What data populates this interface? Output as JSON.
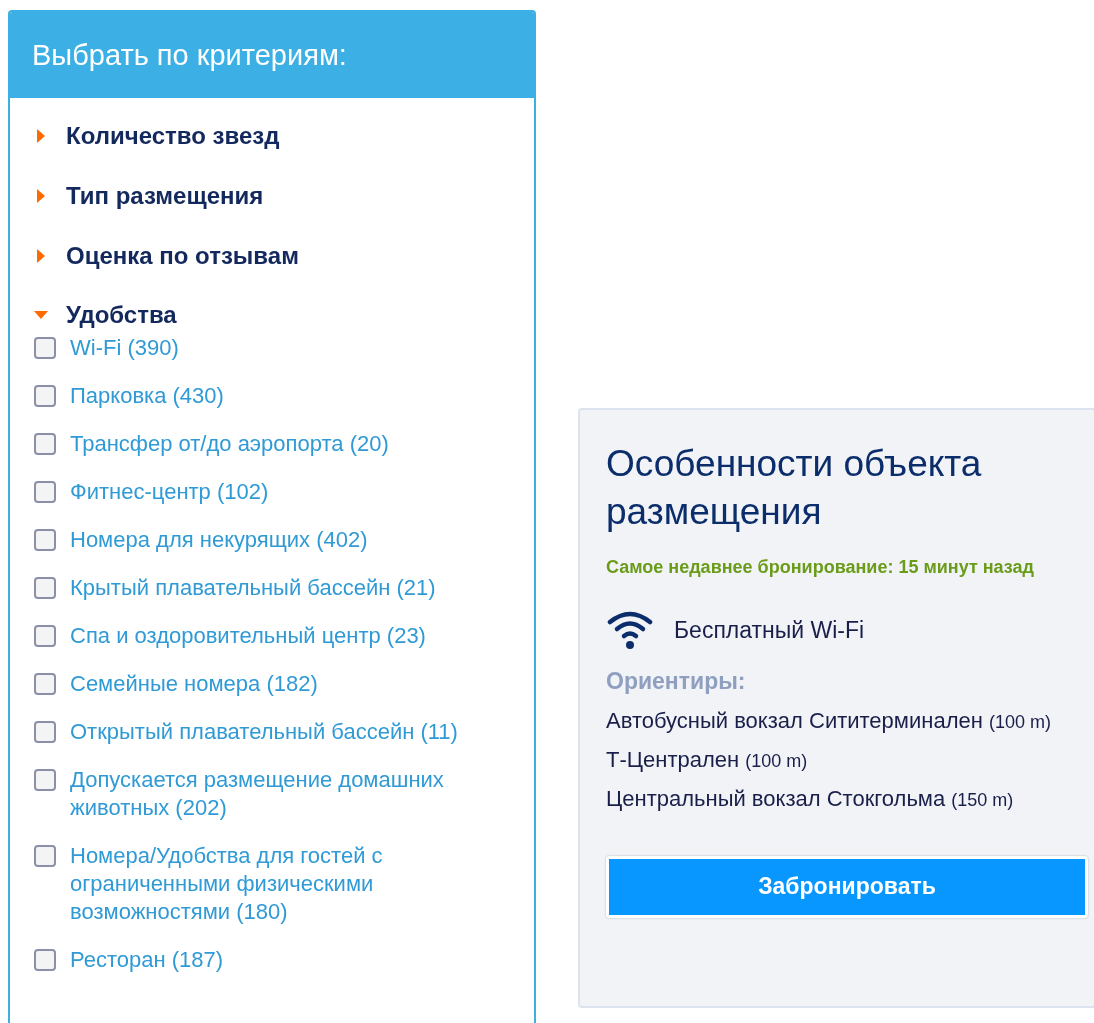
{
  "filter_panel": {
    "title": "Выбрать по критериям:",
    "sections": [
      {
        "label": "Количество звезд",
        "expanded": false
      },
      {
        "label": "Тип размещения",
        "expanded": false
      },
      {
        "label": "Оценка по отзывам",
        "expanded": false
      },
      {
        "label": "Удобства",
        "expanded": true,
        "options": [
          {
            "label": "Wi-Fi (390)",
            "checked": false
          },
          {
            "label": "Парковка (430)",
            "checked": false
          },
          {
            "label": "Трансфер от/до аэропорта (20)",
            "checked": false
          },
          {
            "label": "Фитнес-центр (102)",
            "checked": false
          },
          {
            "label": "Номера для некурящих (402)",
            "checked": false
          },
          {
            "label": "Крытый плавательный бассейн (21)",
            "checked": false
          },
          {
            "label": "Спа и оздоровительный центр (23)",
            "checked": false
          },
          {
            "label": "Семейные номера (182)",
            "checked": false
          },
          {
            "label": "Открытый плавательный бассейн (11)",
            "checked": false
          },
          {
            "label": "Допускается размещение домашних животных (202)",
            "checked": false
          },
          {
            "label": "Номера/Удобства для гостей с ограниченными физическими возможностями (180)",
            "checked": false
          },
          {
            "label": "Ресторан (187)",
            "checked": false
          }
        ]
      }
    ]
  },
  "property_card": {
    "title": "Особенности объекта размещения",
    "recent_booking": "Самое недавнее бронирование: 15 минут назад",
    "feature": "Бесплатный Wi-Fi",
    "landmarks_heading": "Ориентиры:",
    "landmarks": [
      {
        "name": "Автобусный вокзал Сититерминален",
        "distance": "(100 m)"
      },
      {
        "name": "Т-Централен",
        "distance": "(100 m)"
      },
      {
        "name": "Центральный вокзал Стокгольма",
        "distance": "(150 m)"
      }
    ],
    "button": "Забронировать"
  }
}
